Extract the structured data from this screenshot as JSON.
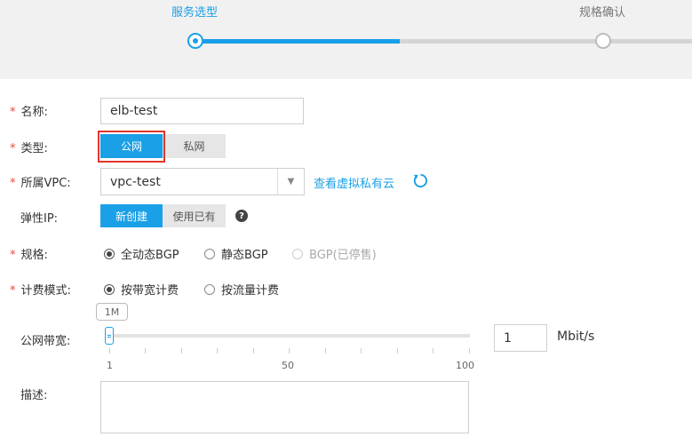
{
  "steps": [
    {
      "label": "服务选型",
      "active": true
    },
    {
      "label": "规格确认",
      "active": false
    }
  ],
  "form": {
    "name": {
      "label": "名称:",
      "value": "elb-test"
    },
    "type": {
      "label": "类型:",
      "options": [
        "公网",
        "私网"
      ],
      "selected": "公网"
    },
    "vpc": {
      "label": "所属VPC:",
      "value": "vpc-test",
      "link": "查看虚拟私有云"
    },
    "eip": {
      "label": "弹性IP:",
      "options": [
        "新创建",
        "使用已有"
      ],
      "selected": "新创建",
      "help": "?"
    },
    "spec": {
      "label": "规格:",
      "options": [
        {
          "label": "全动态BGP",
          "checked": true,
          "disabled": false
        },
        {
          "label": "静态BGP",
          "checked": false,
          "disabled": false
        },
        {
          "label": "BGP(已停售)",
          "checked": false,
          "disabled": true
        }
      ]
    },
    "billing": {
      "label": "计费模式:",
      "options": [
        {
          "label": "按带宽计费",
          "checked": true
        },
        {
          "label": "按流量计费",
          "checked": false
        }
      ]
    },
    "bandwidth": {
      "label": "公网带宽:",
      "tooltip": "1M",
      "ticks": [
        "1",
        "50",
        "100"
      ],
      "value": "1",
      "unit": "Mbit/s",
      "min": 1,
      "max": 100,
      "current": 1
    },
    "description": {
      "label": "描述:",
      "value": ""
    }
  },
  "colors": {
    "accent": "#1aa0e6",
    "required": "#e84a3a",
    "highlight": "#e0352b"
  }
}
